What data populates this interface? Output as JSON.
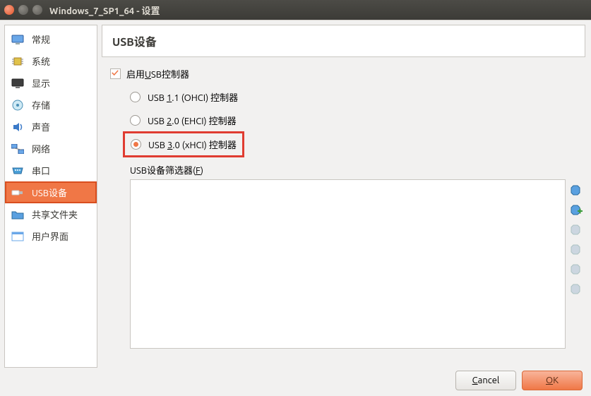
{
  "window": {
    "title": "Windows_7_SP1_64 - 设置"
  },
  "sidebar": {
    "items": [
      {
        "label": "常规",
        "icon": "monitor"
      },
      {
        "label": "系统",
        "icon": "chip"
      },
      {
        "label": "显示",
        "icon": "display"
      },
      {
        "label": "存储",
        "icon": "disk"
      },
      {
        "label": "声音",
        "icon": "audio"
      },
      {
        "label": "网络",
        "icon": "network"
      },
      {
        "label": "串口",
        "icon": "serial"
      },
      {
        "label": "USB设备",
        "icon": "usb",
        "selected": true
      },
      {
        "label": "共享文件夹",
        "icon": "folder"
      },
      {
        "label": "用户界面",
        "icon": "ui"
      }
    ]
  },
  "panel": {
    "title": "USB设备",
    "enable_checkbox": {
      "label": "启用USB控制器",
      "checked": true
    },
    "radios": [
      {
        "label": "USB 1.1 (OHCI) 控制器",
        "underline": "1",
        "selected": false
      },
      {
        "label": "USB 2.0 (EHCI) 控制器",
        "underline": "2",
        "selected": false
      },
      {
        "label": "USB 3.0 (xHCI) 控制器",
        "underline": "3",
        "selected": true,
        "highlighted": true
      }
    ],
    "filter_label": "USB设备筛选器(F)"
  },
  "footer": {
    "cancel": "Cancel",
    "ok": "OK"
  }
}
